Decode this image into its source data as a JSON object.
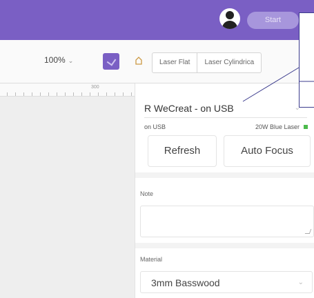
{
  "header": {
    "start_label": "Start"
  },
  "toolbar": {
    "zoom": "100%",
    "zoom_chevron": "⌄",
    "mode_flat": "Laser Flat",
    "mode_cylindrical": "Laser Cylindrica"
  },
  "ruler": {
    "mark": "300"
  },
  "panel": {
    "device_name": "R WeCreat - on USB",
    "device_chevron": "⌄",
    "connection_status": "on USB",
    "laser_type": "20W Blue Laser",
    "refresh_label": "Refresh",
    "autofocus_label": "Auto Focus",
    "note_label": "Note",
    "material_label": "Material",
    "material_value": "3mm Basswood",
    "material_chevron": "⌄"
  },
  "colors": {
    "accent": "#7a5fc4",
    "status_ok": "#4cba4c"
  }
}
